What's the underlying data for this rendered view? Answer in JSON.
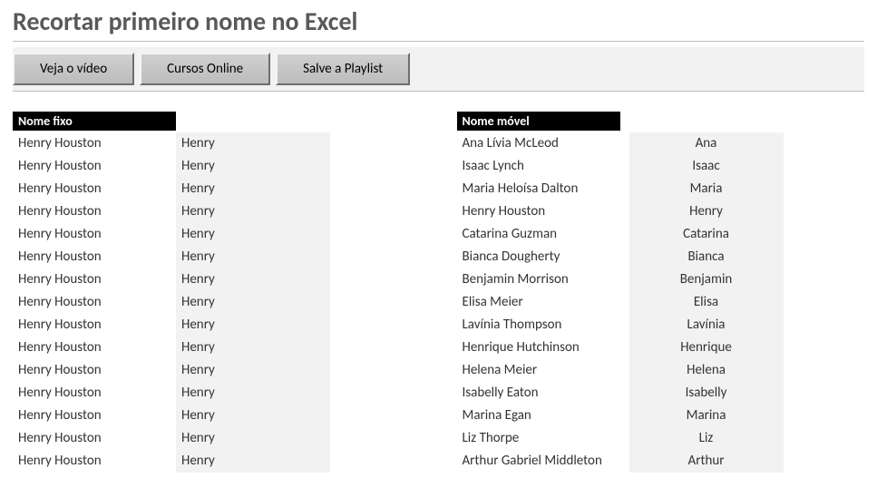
{
  "title": "Recortar primeiro nome no Excel",
  "buttons": {
    "video": "Veja o vídeo",
    "cursos": "Cursos Online",
    "playlist": "Salve a Playlist"
  },
  "left": {
    "header": "Nome fixo",
    "rows": [
      {
        "full": "Henry Houston",
        "first": "Henry"
      },
      {
        "full": "Henry Houston",
        "first": "Henry"
      },
      {
        "full": "Henry Houston",
        "first": "Henry"
      },
      {
        "full": "Henry Houston",
        "first": "Henry"
      },
      {
        "full": "Henry Houston",
        "first": "Henry"
      },
      {
        "full": "Henry Houston",
        "first": "Henry"
      },
      {
        "full": "Henry Houston",
        "first": "Henry"
      },
      {
        "full": "Henry Houston",
        "first": "Henry"
      },
      {
        "full": "Henry Houston",
        "first": "Henry"
      },
      {
        "full": "Henry Houston",
        "first": "Henry"
      },
      {
        "full": "Henry Houston",
        "first": "Henry"
      },
      {
        "full": "Henry Houston",
        "first": "Henry"
      },
      {
        "full": "Henry Houston",
        "first": "Henry"
      },
      {
        "full": "Henry Houston",
        "first": "Henry"
      },
      {
        "full": "Henry Houston",
        "first": "Henry"
      }
    ]
  },
  "right": {
    "header": "Nome móvel",
    "rows": [
      {
        "full": "Ana Lívia McLeod",
        "first": "Ana"
      },
      {
        "full": "Isaac Lynch",
        "first": "Isaac"
      },
      {
        "full": "Maria Heloísa Dalton",
        "first": "Maria"
      },
      {
        "full": "Henry Houston",
        "first": "Henry"
      },
      {
        "full": "Catarina Guzman",
        "first": "Catarina"
      },
      {
        "full": "Bianca Dougherty",
        "first": "Bianca"
      },
      {
        "full": "Benjamin Morrison",
        "first": "Benjamin"
      },
      {
        "full": "Elisa Meier",
        "first": "Elisa"
      },
      {
        "full": "Lavínia Thompson",
        "first": "Lavínia"
      },
      {
        "full": "Henrique Hutchinson",
        "first": "Henrique"
      },
      {
        "full": "Helena Meier",
        "first": "Helena"
      },
      {
        "full": "Isabelly Eaton",
        "first": "Isabelly"
      },
      {
        "full": "Marina Egan",
        "first": "Marina"
      },
      {
        "full": "Liz Thorpe",
        "first": "Liz"
      },
      {
        "full": "Arthur Gabriel Middleton",
        "first": "Arthur"
      }
    ]
  }
}
